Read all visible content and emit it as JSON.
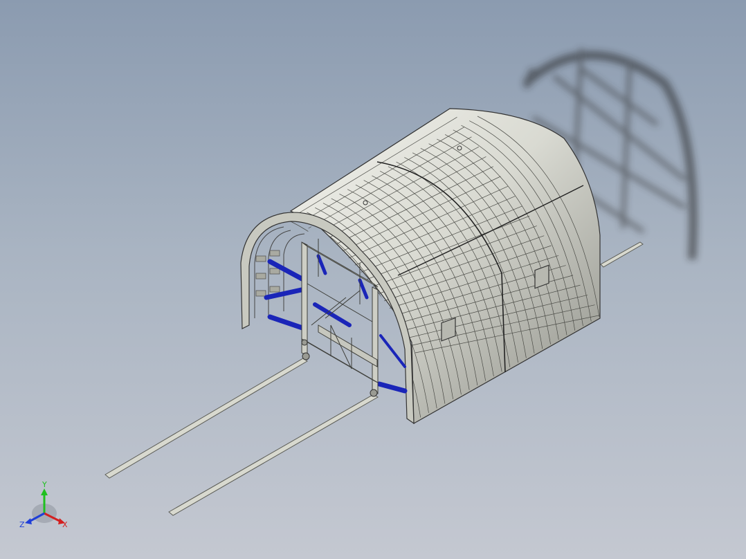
{
  "triad": {
    "x_label": "X",
    "y_label": "Y",
    "z_label": "Z",
    "x_color": "#d32020",
    "y_color": "#1fc01f",
    "z_color": "#1f3fd8"
  },
  "icons": [
    "triad-icon",
    "shadow"
  ],
  "colors": {
    "background_top": "#8b9bb0",
    "background_bottom": "#c4c8d1",
    "shell": "#cfd0c8",
    "frame": "#c7c8be",
    "jacks": "#1f2fd0",
    "rail": "#cfd0c6"
  }
}
